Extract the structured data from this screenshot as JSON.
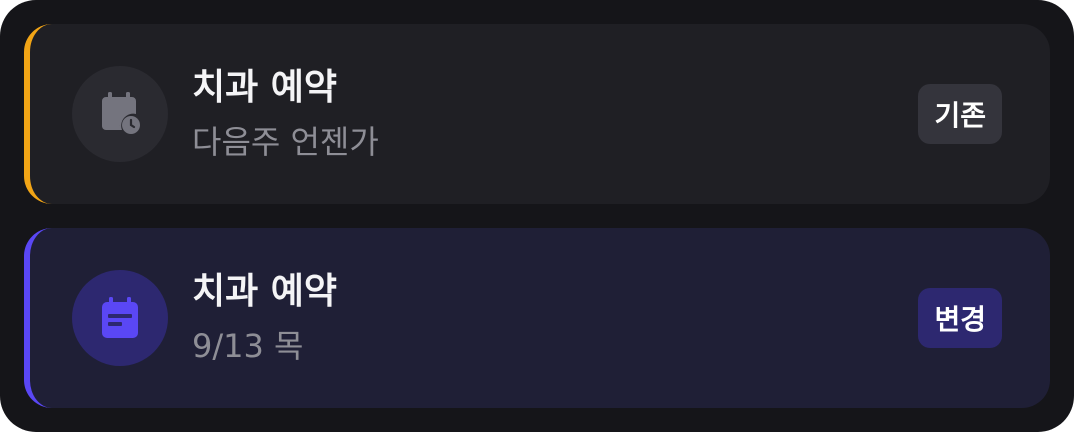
{
  "cards": [
    {
      "title": "치과 예약",
      "subtitle": "다음주 언젠가",
      "badge": "기존",
      "icon": "calendar-clock-icon",
      "accent_color": "#f2a516"
    },
    {
      "title": "치과 예약",
      "subtitle": "9/13 목",
      "badge": "변경",
      "icon": "calendar-event-icon",
      "accent_color": "#5a47f5"
    }
  ]
}
